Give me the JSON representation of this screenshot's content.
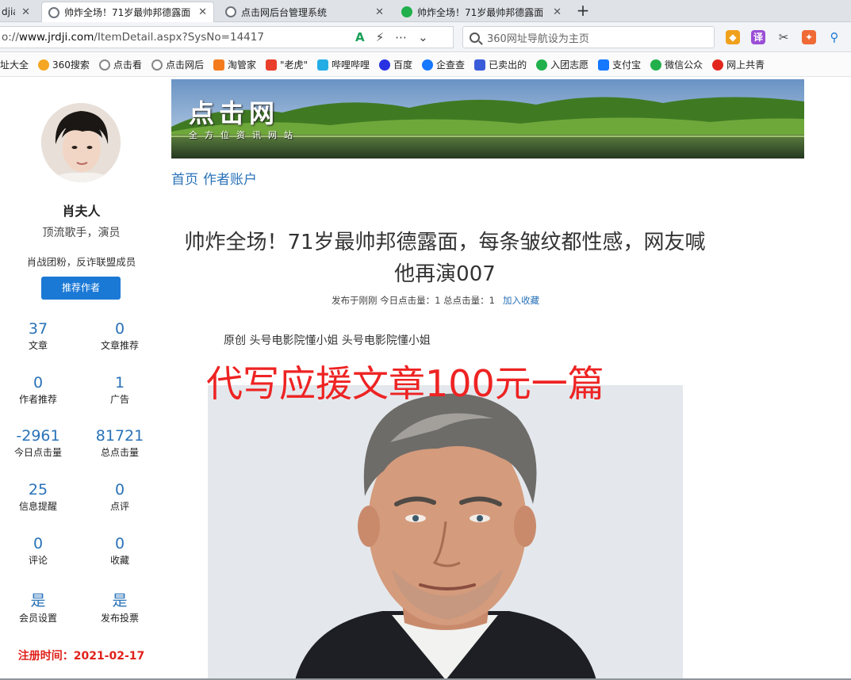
{
  "browser": {
    "tabs": [
      {
        "title": "djia",
        "icon": "globe-icon",
        "active": false
      },
      {
        "title": "帅炸全场！71岁最帅邦德露面",
        "icon": "globe-icon",
        "active": true
      },
      {
        "title": "点击网后台管理系统",
        "icon": "globe-icon",
        "active": false
      },
      {
        "title": "帅炸全场！71岁最帅邦德露面",
        "icon": "wechat-icon",
        "active": false
      }
    ],
    "close_glyph": "✕",
    "new_tab_glyph": "+",
    "url_prefix": "o://",
    "url_host": "www.jrdji.com",
    "url_path": "/ItemDetail.aspx?SysNo=14417",
    "search_placeholder": "360网址导航设为主页",
    "bookmarks": [
      {
        "label": "址大全",
        "icon": "none"
      },
      {
        "label": "360搜索",
        "icon": "360-search-icon",
        "color": "#f5a623"
      },
      {
        "label": "点击看",
        "icon": "globe-icon",
        "color": "#888888"
      },
      {
        "label": "点击网后",
        "icon": "globe-icon",
        "color": "#888888"
      },
      {
        "label": "淘管家",
        "icon": "taoguanjia-icon",
        "color": "#f37b1d"
      },
      {
        "label": "\"老虎\"",
        "icon": "kuaishou-icon",
        "color": "#e83e2b"
      },
      {
        "label": "哔哩哔哩",
        "icon": "bilibili-icon",
        "color": "#23ade5"
      },
      {
        "label": "百度",
        "icon": "baidu-icon",
        "color": "#2932e1"
      },
      {
        "label": "企查查",
        "icon": "qichacha-icon",
        "color": "#1677ff"
      },
      {
        "label": "已卖出的",
        "icon": "taobao-icon",
        "color": "#3a5bd9"
      },
      {
        "label": "入团志愿",
        "icon": "wechat-icon",
        "color": "#21b04b"
      },
      {
        "label": "支付宝",
        "icon": "alipay-icon",
        "color": "#1677ff"
      },
      {
        "label": "微信公众",
        "icon": "wechat-icon",
        "color": "#21b04b"
      },
      {
        "label": "网上共青",
        "icon": "youth-league-icon",
        "color": "#e2261e"
      }
    ]
  },
  "profile": {
    "name": "肖夫人",
    "role": "顶流歌手，演员",
    "motto": "肖战团粉，反诈联盟成员",
    "recommend_button": "推荐作者",
    "stats": [
      {
        "value": "37",
        "label": "文章"
      },
      {
        "value": "0",
        "label": "文章推荐"
      },
      {
        "value": "0",
        "label": "作者推荐"
      },
      {
        "value": "1",
        "label": "广告"
      },
      {
        "value": "-2961",
        "label": "今日点击量"
      },
      {
        "value": "81721",
        "label": "总点击量"
      },
      {
        "value": "25",
        "label": "信息提醒"
      },
      {
        "value": "0",
        "label": "点评"
      },
      {
        "value": "0",
        "label": "评论"
      },
      {
        "value": "0",
        "label": "收藏"
      },
      {
        "value": "是",
        "label": "会员设置"
      },
      {
        "value": "是",
        "label": "发布投票"
      }
    ],
    "registered": "注册时间：2021-02-17"
  },
  "site": {
    "banner_title": "点击网",
    "banner_subtitle": "全方位资讯网站",
    "nav": [
      "首页",
      "作者账户"
    ]
  },
  "article": {
    "title": "帅炸全场！71岁最帅邦德露面，每条皱纹都性感，网友喊他再演007",
    "meta": "发布于刚刚 今日点击量：1 总点击量：1",
    "favorite_link": "加入收藏",
    "source": "原创 头号电影院懂小姐 头号电影院懂小姐",
    "overlay_text": "代写应援文章100元一篇"
  },
  "colors": {
    "link_blue": "#2a72b8",
    "button_blue": "#1b79d6",
    "overlay_red": "#ee2323",
    "register_red": "#e0211a"
  }
}
